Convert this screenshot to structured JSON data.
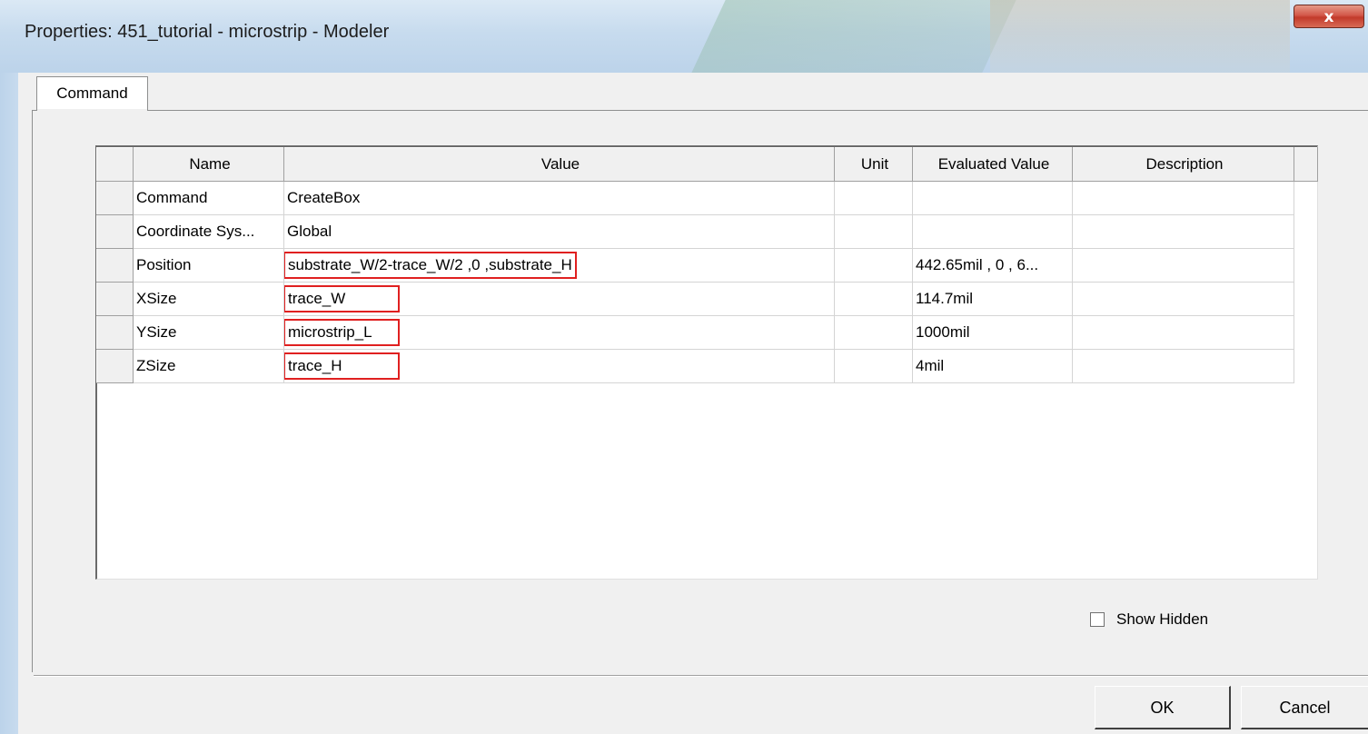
{
  "window": {
    "title": "Properties: 451_tutorial - microstrip - Modeler",
    "close_glyph": "x"
  },
  "tabs": [
    {
      "label": "Command",
      "selected": true
    }
  ],
  "table": {
    "columns": [
      "Name",
      "Value",
      "Unit",
      "Evaluated Value",
      "Description"
    ],
    "rows": [
      {
        "name": "Command",
        "value": "CreateBox",
        "unit": "",
        "evaluated": "",
        "description": "",
        "highlighted": false
      },
      {
        "name": "Coordinate Sys...",
        "value": "Global",
        "unit": "",
        "evaluated": "",
        "description": "",
        "highlighted": false
      },
      {
        "name": "Position",
        "value": "substrate_W/2-trace_W/2 ,0 ,substrate_H",
        "unit": "",
        "evaluated": "442.65mil , 0 , 6...",
        "description": "",
        "highlighted": true
      },
      {
        "name": "XSize",
        "value": "trace_W",
        "unit": "",
        "evaluated": "114.7mil",
        "description": "",
        "highlighted": true
      },
      {
        "name": "YSize",
        "value": "microstrip_L",
        "unit": "",
        "evaluated": "1000mil",
        "description": "",
        "highlighted": true
      },
      {
        "name": "ZSize",
        "value": "trace_H",
        "unit": "",
        "evaluated": "4mil",
        "description": "",
        "highlighted": true
      }
    ]
  },
  "show_hidden": {
    "label": "Show Hidden",
    "checked": false
  },
  "buttons": {
    "ok": "OK",
    "cancel": "Cancel"
  },
  "colors": {
    "highlight_border": "#e02020",
    "close_button": "#c23a2b"
  }
}
